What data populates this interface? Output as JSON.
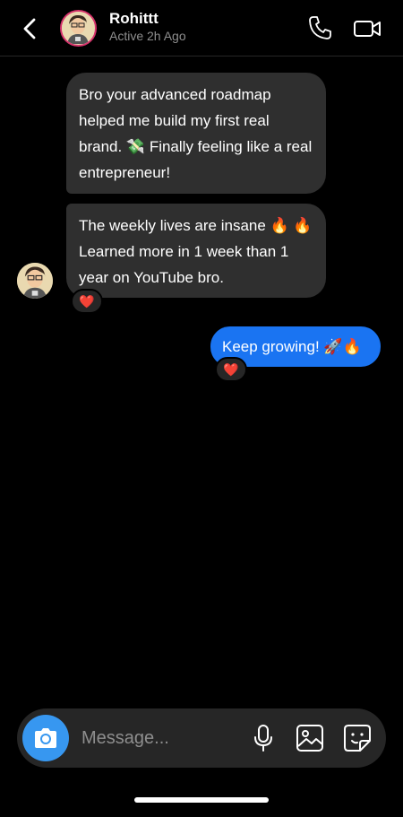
{
  "header": {
    "name": "Rohittt",
    "status": "Active 2h Ago",
    "icons": {
      "back": "chevron-left-icon",
      "call": "phone-icon",
      "video": "video-camera-icon"
    }
  },
  "messages": [
    {
      "from": "them",
      "text": "Bro your advanced roadmap helped me build my first real brand. 💸 Finally feeling like a real entrepreneur!"
    },
    {
      "from": "them",
      "text": "The weekly lives are insane 🔥 🔥 Learned more in 1 week than 1 year on YouTube bro.",
      "reaction": "❤️"
    },
    {
      "from": "me",
      "text": "Keep growing! 🚀🔥",
      "reaction": "❤️"
    }
  ],
  "composer": {
    "placeholder": "Message...",
    "icons": [
      "camera-icon",
      "microphone-icon",
      "image-icon",
      "sticker-icon"
    ]
  },
  "colors": {
    "background": "#000000",
    "incoming_bubble": "#2f2f2f",
    "outgoing_bubble": "#1a74f2",
    "camera_button": "#3797f0",
    "avatar_ring": "#d6336c"
  }
}
